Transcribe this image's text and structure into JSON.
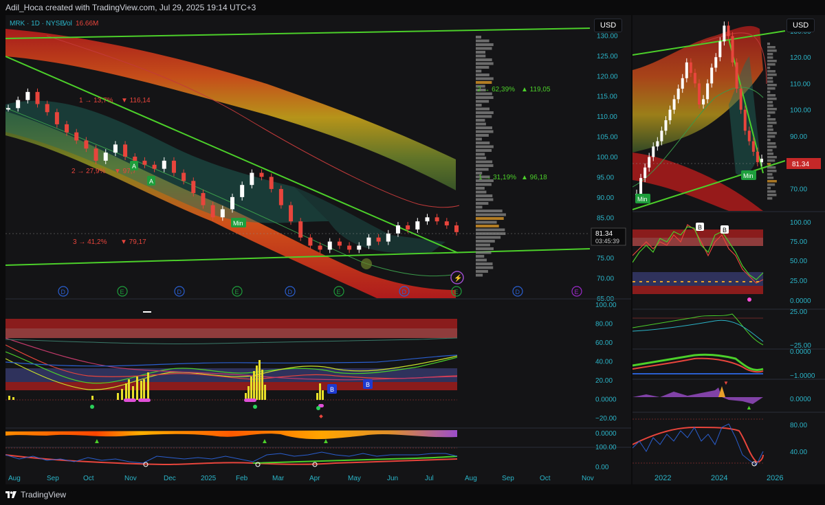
{
  "header": {
    "caption": "Adil_Hoca created with TradingView.com, Jul 29, 2025 19:14 UTC+3"
  },
  "legend": {
    "symbol": "MRK · 1D · NYSE",
    "vol_label": "Vol",
    "vol_value": "16.66M"
  },
  "currency": "USD",
  "price_tag": {
    "price": "81.34",
    "countdown": "03:45:39"
  },
  "right_price_tag": "81.34",
  "fib_labels": [
    {
      "text": "1 → 13,7%",
      "price": "▼ 116,14"
    },
    {
      "text": "2 → 27,9%",
      "price": "▼ 97,7"
    },
    {
      "text": "3 → 41,2%",
      "price": "▼ 79,17"
    },
    {
      "text": "2 → 62,39%",
      "price": "▲ 119,05"
    },
    {
      "text": "1 → 31,19%",
      "price": "▲ 96,18"
    }
  ],
  "markers": {
    "min": "Min",
    "buy": "B",
    "a": "A",
    "d": "D",
    "e": "E"
  },
  "branding": {
    "logo_text": "TradingView"
  },
  "colors": {
    "bg": "#141416",
    "up": "#ffffff",
    "down": "#e8453c",
    "trend": "#4cd02a",
    "fib_red": "#e8453c",
    "fib_green": "#4cd02a",
    "axis_text": "#2bb5c9"
  },
  "chart_data": [
    {
      "type": "candlestick",
      "title": "MRK · 1D · NYSE",
      "xlabel": "",
      "ylabel": "USD",
      "ylim": [
        65,
        135
      ],
      "y_ticks": [
        "130.00",
        "125.00",
        "120.00",
        "115.00",
        "110.00",
        "105.00",
        "100.00",
        "95.00",
        "90.00",
        "85.00",
        "80.00",
        "75.00",
        "70.00",
        "65.00"
      ],
      "x_ticks": [
        "Aug",
        "Sep",
        "Oct",
        "Nov",
        "Dec",
        "2025",
        "Feb",
        "Mar",
        "Apr",
        "May",
        "Jun",
        "Jul",
        "Aug",
        "Sep",
        "Oct",
        "Nov"
      ],
      "series": [
        {
          "name": "MRK",
          "values": [
            112,
            114,
            116,
            113,
            111,
            108,
            106,
            104,
            102,
            99,
            101,
            103,
            100,
            99,
            98,
            97,
            99,
            96,
            94,
            91,
            88,
            85,
            87,
            90,
            93,
            96,
            95,
            92,
            88,
            84,
            80,
            78,
            77,
            79,
            78,
            77,
            78,
            80,
            79,
            81,
            83,
            82,
            84,
            85,
            84,
            83,
            81.34
          ]
        }
      ],
      "last_price": 81.34
    },
    {
      "type": "line",
      "title": "",
      "ylim": [
        -30,
        105
      ],
      "y_ticks": [
        "100.00",
        "80.00",
        "60.00",
        "40.00",
        "20.00",
        "0.0000",
        "−20.00"
      ]
    },
    {
      "type": "area",
      "title": "",
      "ylim": [
        -2,
        2
      ],
      "y_ticks": [
        "0.0000"
      ]
    },
    {
      "type": "line",
      "title": "",
      "ylim": [
        -5,
        105
      ],
      "y_ticks": [
        "100.00",
        "0.00"
      ]
    },
    {
      "type": "candlestick",
      "title": "",
      "ylim": [
        62,
        136
      ],
      "y_ticks": [
        "130.00",
        "120.00",
        "110.00",
        "100.00",
        "90.00",
        "80.00",
        "70.00"
      ],
      "x_ticks": [
        "2022",
        "2024",
        "2026"
      ],
      "series": [
        {
          "name": "MRK",
          "values": [
            68,
            74,
            78,
            82,
            86,
            88,
            92,
            96,
            100,
            104,
            108,
            112,
            118,
            114,
            110,
            102,
            104,
            110,
            116,
            120,
            126,
            132,
            128,
            118,
            108,
            100,
            92,
            88,
            84,
            80,
            81.34
          ]
        }
      ]
    },
    {
      "type": "line",
      "title": "",
      "ylim": [
        -5,
        105
      ],
      "y_ticks": [
        "100.00",
        "75.00",
        "50.00",
        "25.00",
        "0.0000"
      ]
    },
    {
      "type": "line",
      "title": "",
      "ylim": [
        -30,
        30
      ],
      "y_ticks": [
        "25.00",
        "−25.00"
      ]
    },
    {
      "type": "line",
      "title": "",
      "ylim": [
        -1.2,
        0.2
      ],
      "y_ticks": [
        "0.0000",
        "−1.0000"
      ]
    },
    {
      "type": "area",
      "title": "",
      "ylim": [
        -1,
        1
      ],
      "y_ticks": [
        "0.0000"
      ]
    },
    {
      "type": "line",
      "title": "",
      "ylim": [
        20,
        100
      ],
      "y_ticks": [
        "80.00",
        "40.00"
      ]
    }
  ]
}
